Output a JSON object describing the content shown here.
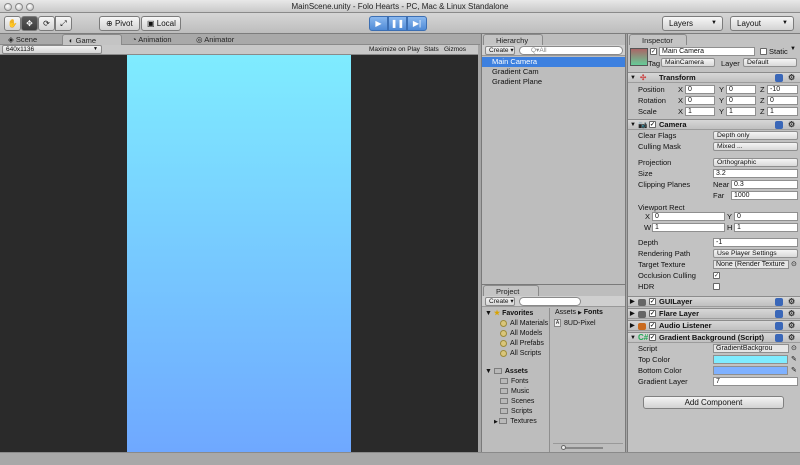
{
  "window": {
    "title": "MainScene.unity - Folo Hearts - PC, Mac & Linux Standalone"
  },
  "toolbar": {
    "pivot": "Pivot",
    "local": "Local",
    "layers": "Layers",
    "layout": "Layout",
    "colors": {
      "play_accent": "#4f8ad6"
    }
  },
  "view_tabs": {
    "scene": "Scene",
    "game": "Game",
    "animation": "Animation",
    "animator": "Animator"
  },
  "game": {
    "resolution": "640x1136",
    "maximize": "Maximize on Play",
    "stats": "Stats",
    "gizmos": "Gizmos",
    "gradient_top": "#7fecff",
    "gradient_bottom": "#6fa8ff"
  },
  "hierarchy": {
    "tab": "Hierarchy",
    "create": "Create",
    "search_placeholder": "Q▾All",
    "items": [
      "Main Camera",
      "Gradient Cam",
      "Gradient Plane"
    ]
  },
  "project": {
    "tab": "Project",
    "create": "Create",
    "favorites": "Favorites",
    "favorite_items": [
      "All Materials",
      "All Models",
      "All Prefabs",
      "All Scripts"
    ],
    "assets": "Assets",
    "asset_folders": [
      "Fonts",
      "Music",
      "Scenes",
      "Scripts",
      "Textures"
    ],
    "breadcrumb_root": "Assets",
    "breadcrumb_sep": "▶",
    "breadcrumb_current": "Fonts",
    "files": [
      "8UD-Pixel"
    ]
  },
  "inspector": {
    "tab": "Inspector",
    "object_name": "Main Camera",
    "static": "Static",
    "tag_label": "Tag",
    "tag": "MainCamera",
    "layer_label": "Layer",
    "layer": "Default",
    "transform": {
      "title": "Transform",
      "position_label": "Position",
      "position": [
        "0",
        "0",
        "-10"
      ],
      "rotation_label": "Rotation",
      "rotation": [
        "0",
        "0",
        "0"
      ],
      "scale_label": "Scale",
      "scale": [
        "1",
        "1",
        "1"
      ],
      "x": "X",
      "y": "Y",
      "z": "Z"
    },
    "camera": {
      "title": "Camera",
      "clear_flags_label": "Clear Flags",
      "clear_flags": "Depth only",
      "culling_mask_label": "Culling Mask",
      "culling_mask": "Mixed ...",
      "projection_label": "Projection",
      "projection": "Orthographic",
      "size_label": "Size",
      "size": "3.2",
      "clipping_label": "Clipping Planes",
      "near_label": "Near",
      "near": "0.3",
      "far_label": "Far",
      "far": "1000",
      "viewport_label": "Viewport Rect",
      "vp_x_label": "X",
      "vp_x": "0",
      "vp_y_label": "Y",
      "vp_y": "0",
      "vp_w_label": "W",
      "vp_w": "1",
      "vp_h_label": "H",
      "vp_h": "1",
      "depth_label": "Depth",
      "depth": "-1",
      "rendering_path_label": "Rendering Path",
      "rendering_path": "Use Player Settings",
      "target_texture_label": "Target Texture",
      "target_texture": "None (Render Texture",
      "occlusion_label": "Occlusion Culling",
      "hdr_label": "HDR"
    },
    "components": [
      "GUILayer",
      "Flare Layer",
      "Audio Listener"
    ],
    "gradient_bg": {
      "title": "Gradient Background (Script)",
      "script_label": "Script",
      "script": "GradientBackgrou",
      "top_color_label": "Top Color",
      "top_color": "#7fecff",
      "bottom_color_label": "Bottom Color",
      "bottom_color": "#7fb1ff",
      "gradient_layer_label": "Gradient Layer",
      "gradient_layer": "7"
    },
    "add_component": "Add Component"
  }
}
